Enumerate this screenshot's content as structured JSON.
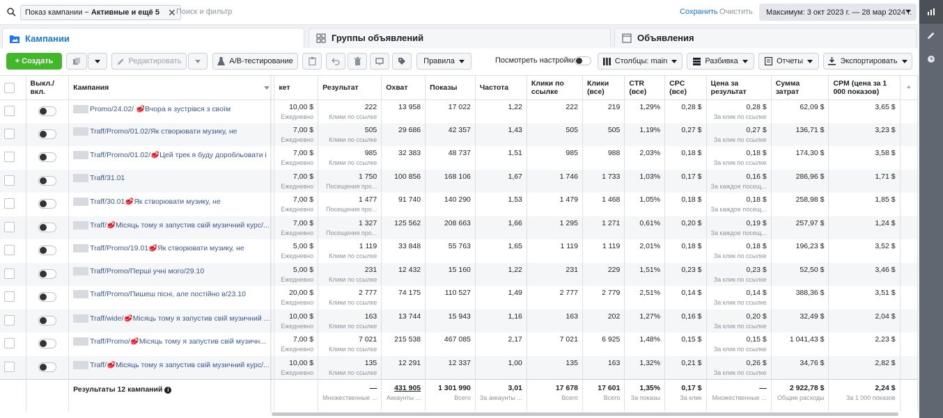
{
  "search": {
    "chip_prefix": "Показ кампании − ",
    "chip_bold": "Активные и ещё 5",
    "placeholder": "Поиск и фильтр",
    "save": "Сохранить",
    "clear": "Очистить"
  },
  "date_range": "Максимум: 3 окт 2023 г. — 28 мар 2024 г.",
  "tabs": [
    {
      "label": "Кампании",
      "icon": "folder-icon"
    },
    {
      "label": "Группы объявлений",
      "icon": "grid-icon"
    },
    {
      "label": "Объявления",
      "icon": "ad-icon"
    }
  ],
  "toolbar": {
    "create": "+ Создать",
    "edit": "Редактировать",
    "ab_test": "A/B-тестирование",
    "rules": "Правила",
    "view_settings": "Посмотреть настройки",
    "columns": "Столбцы: main",
    "breakdown": "Разбивка",
    "reports": "Отчеты",
    "export": "Экспортировать"
  },
  "headers": {
    "toggle": "Выкл./вкл.",
    "campaign": "Кампания",
    "budget": "кет",
    "result": "Результат",
    "reach": "Охват",
    "impressions": "Показы",
    "frequency": "Частота",
    "link_clicks": "Клики по ссылке",
    "clicks_all": "Клики (все)",
    "ctr": "CTR (все)",
    "cpc": "CPC (все)",
    "cost_per_result": "Цена за результат",
    "spend": "Сумма затрат",
    "cpm": "CPM (цена за 1 000 показов)"
  },
  "rows": [
    {
      "campaign": "Promo/24.02/ 🥩Вчора я зустрівся з своїм",
      "budget": "10,00 $",
      "budget_sub": "Ежедневно",
      "result": "222",
      "result_sub": "Клики по ссылке",
      "reach": "13 958",
      "impressions": "17 022",
      "frequency": "1,22",
      "link_clicks": "222",
      "clicks_all": "219",
      "ctr": "1,29%",
      "cpc": "0,28 $",
      "cpr": "0,28 $",
      "cpr_sub": "За клик по ссылке",
      "spend": "62,09 $",
      "cpm": "3,65 $"
    },
    {
      "campaign": "Traff/Promo/01.02/Як створювати музику, не",
      "budget": "7,00 $",
      "budget_sub": "Ежедневно",
      "result": "505",
      "result_sub": "Клики по ссылке",
      "reach": "29 686",
      "impressions": "42 357",
      "frequency": "1,43",
      "link_clicks": "505",
      "clicks_all": "505",
      "ctr": "1,19%",
      "cpc": "0,27 $",
      "cpr": "0,27 $",
      "cpr_sub": "За клик по ссылке",
      "spend": "136,71 $",
      "cpm": "3,23 $"
    },
    {
      "campaign": "Traff/Promo/01.02/🥩Цей трек я буду доробльовати і",
      "budget": "7,00 $",
      "budget_sub": "Ежедневно",
      "result": "985",
      "result_sub": "Клики по ссылке",
      "reach": "32 383",
      "impressions": "48 737",
      "frequency": "1,51",
      "link_clicks": "985",
      "clicks_all": "988",
      "ctr": "2,03%",
      "cpc": "0,18 $",
      "cpr": "0,18 $",
      "cpr_sub": "За клик по ссылке",
      "spend": "174,30 $",
      "cpm": "3,58 $"
    },
    {
      "campaign": "Traff/31.01",
      "budget": "7,00 $",
      "budget_sub": "Ежедневно",
      "result": "1 750",
      "result_sub": "Посещения про...",
      "reach": "100 856",
      "impressions": "168 106",
      "frequency": "1,67",
      "link_clicks": "1 746",
      "clicks_all": "1 733",
      "ctr": "1,03%",
      "cpc": "0,17 $",
      "cpr": "0,16 $",
      "cpr_sub": "За каждое посещ...",
      "spend": "286,96 $",
      "cpm": "1,71 $"
    },
    {
      "campaign": "Traff/30.01🥩Як створювати музику, не",
      "budget": "7,00 $",
      "budget_sub": "Ежедневно",
      "result": "1 477",
      "result_sub": "Посещения про...",
      "reach": "91 740",
      "impressions": "140 290",
      "frequency": "1,53",
      "link_clicks": "1 479",
      "clicks_all": "1 468",
      "ctr": "1,05%",
      "cpc": "0,18 $",
      "cpr": "0,18 $",
      "cpr_sub": "За каждое посещ...",
      "spend": "258,98 $",
      "cpm": "1,85 $"
    },
    {
      "campaign": "Traff/🥩Місяць тому я запустив свій музичний курс/...",
      "budget": "7,00 $",
      "budget_sub": "Ежедневно",
      "result": "1 327",
      "result_sub": "Посещения про...",
      "reach": "125 562",
      "impressions": "208 663",
      "frequency": "1,66",
      "link_clicks": "1 295",
      "clicks_all": "1 271",
      "ctr": "0,61%",
      "cpc": "0,20 $",
      "cpr": "0,19 $",
      "cpr_sub": "За каждое посещ...",
      "spend": "257,97 $",
      "cpm": "1,24 $"
    },
    {
      "campaign": "Traff/Promo/19.01🥩Як створювати музику, не",
      "budget": "5,00 $",
      "budget_sub": "Ежедневно",
      "result": "1 119",
      "result_sub": "Клики по ссылке",
      "reach": "33 848",
      "impressions": "55 763",
      "frequency": "1,65",
      "link_clicks": "1 119",
      "clicks_all": "1 119",
      "ctr": "2,01%",
      "cpc": "0,18 $",
      "cpr": "0,18 $",
      "cpr_sub": "За клик по ссылке",
      "spend": "196,23 $",
      "cpm": "3,52 $"
    },
    {
      "campaign": "Traff/Promo/Перші учні мого/29.10",
      "budget": "5,00 $",
      "budget_sub": "Ежедневно",
      "result": "231",
      "result_sub": "Клики по ссылке",
      "reach": "12 432",
      "impressions": "15 160",
      "frequency": "1,22",
      "link_clicks": "231",
      "clicks_all": "229",
      "ctr": "1,51%",
      "cpc": "0,23 $",
      "cpr": "0,23 $",
      "cpr_sub": "За клик по ссылке",
      "spend": "52,50 $",
      "cpm": "3,46 $"
    },
    {
      "campaign": "Traff/Promo/Пишеш пісні, але постійно в/23.10",
      "budget": "20,00 $",
      "budget_sub": "Ежедневно",
      "result": "2 777",
      "result_sub": "Клики по ссылке",
      "reach": "74 175",
      "impressions": "110 527",
      "frequency": "1,49",
      "link_clicks": "2 777",
      "clicks_all": "2 779",
      "ctr": "2,51%",
      "cpc": "0,14 $",
      "cpr": "0,14 $",
      "cpr_sub": "За клик по ссылке",
      "spend": "388,36 $",
      "cpm": "3,51 $"
    },
    {
      "campaign": "Traff/wide/🥩Місяць тому я запустив свій музичний ...",
      "budget": "10,00 $",
      "budget_sub": "Ежедневно",
      "result": "163",
      "result_sub": "Клики по ссылке",
      "reach": "13 744",
      "impressions": "15 943",
      "frequency": "1,16",
      "link_clicks": "163",
      "clicks_all": "202",
      "ctr": "1,27%",
      "cpc": "0,16 $",
      "cpr": "0,20 $",
      "cpr_sub": "За клик по ссылке",
      "spend": "32,49 $",
      "cpm": "2,04 $"
    },
    {
      "campaign": "Traff/Promo/🥩Місяць тому я запустив свій музичн...",
      "budget": "7,00 $",
      "budget_sub": "Ежедневно",
      "result": "7 021",
      "result_sub": "Клики по ссылке",
      "reach": "215 538",
      "impressions": "467 085",
      "frequency": "2,17",
      "link_clicks": "7 021",
      "clicks_all": "6 925",
      "ctr": "1,48%",
      "cpc": "0,15 $",
      "cpr": "0,15 $",
      "cpr_sub": "За клик по ссылке",
      "spend": "1 041,43 $",
      "cpm": "2,23 $"
    },
    {
      "campaign": "Traff/🥩Місяць тому я запустив свій музичний курс/...",
      "budget": "10,00 $",
      "budget_sub": "Ежедневно",
      "result": "135",
      "result_sub": "Клики по ссылке",
      "reach": "12 291",
      "impressions": "12 337",
      "frequency": "1,00",
      "link_clicks": "135",
      "clicks_all": "163",
      "ctr": "1,32%",
      "cpc": "0,21 $",
      "cpr": "0,26 $",
      "cpr_sub": "За клик по ссылке",
      "spend": "34,76 $",
      "cpm": "2,82 $"
    }
  ],
  "totals": {
    "label": "Результаты 12 кампаний",
    "result": "—",
    "result_sub": "Множественные ...",
    "reach": "431 905",
    "reach_sub": "Аккаунты ...",
    "impressions": "1 301 990",
    "impressions_sub": "Всего",
    "frequency": "3,01",
    "frequency_sub": "За аккаунты ...",
    "link_clicks": "17 678",
    "link_clicks_sub": "Всего",
    "clicks_all": "17 601",
    "clicks_all_sub": "Всего",
    "ctr": "1,35%",
    "ctr_sub": "За показы",
    "cpc": "0,17 $",
    "cpc_sub": "За клик",
    "cpr": "—",
    "cpr_sub": "Множественные ...",
    "spend": "2 922,78 $",
    "spend_sub": "Общие расходы",
    "cpm": "2,24 $",
    "cpm_sub": "За 1 000 показов"
  },
  "colors": {
    "accent": "#1877f2",
    "create": "#42b72a",
    "link": "#385898"
  }
}
